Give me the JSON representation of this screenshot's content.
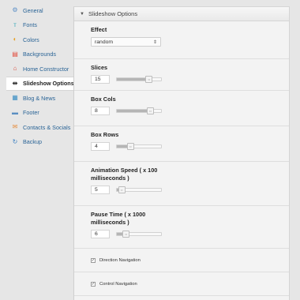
{
  "sidebar": {
    "items": [
      {
        "label": "General",
        "icon": "gear-icon",
        "glyph": "⚙",
        "color": "#5b8fc7"
      },
      {
        "label": "Fonts",
        "icon": "fonts-icon",
        "glyph": "ᴛ",
        "color": "#3aa8b8"
      },
      {
        "label": "Colors",
        "icon": "colors-icon",
        "glyph": "◐",
        "color": "#e6a227"
      },
      {
        "label": "Backgrounds",
        "icon": "backgrounds-icon",
        "glyph": "▤",
        "color": "#e24a3b"
      },
      {
        "label": "Home Constructor",
        "icon": "home-constructor-icon",
        "glyph": "⌂",
        "color": "#d9503f"
      },
      {
        "label": "Slideshow Options",
        "icon": "slideshow-icon",
        "glyph": "⇹",
        "color": "#333333",
        "active": true
      },
      {
        "label": "Blog & News",
        "icon": "blog-icon",
        "glyph": "▦",
        "color": "#3c8fc4"
      },
      {
        "label": "Footer",
        "icon": "footer-icon",
        "glyph": "▬",
        "color": "#5a8ec2"
      },
      {
        "label": "Contacts & Socials",
        "icon": "contacts-icon",
        "glyph": "✉",
        "color": "#e58b3b"
      },
      {
        "label": "Backup",
        "icon": "backup-icon",
        "glyph": "↻",
        "color": "#3b7fc1"
      }
    ]
  },
  "panel": {
    "title": "Slideshow Options",
    "effect": {
      "label": "Effect",
      "value": "random"
    },
    "sliders": [
      {
        "label": "Slices",
        "value": "15",
        "fill": 0.72
      },
      {
        "label": "Box Cols",
        "value": "8",
        "fill": 0.75
      },
      {
        "label": "Box Rows",
        "value": "4",
        "fill": 0.3
      },
      {
        "label": "Animation Speed ( x 100 milliseconds )",
        "value": "5",
        "fill": 0.1
      },
      {
        "label": "Pause Time ( x 1000 milliseconds )",
        "value": "6",
        "fill": 0.2
      }
    ],
    "checks": [
      {
        "label": "Direction Navigation",
        "checked": true
      },
      {
        "label": "Control Navigation",
        "checked": true
      }
    ]
  }
}
